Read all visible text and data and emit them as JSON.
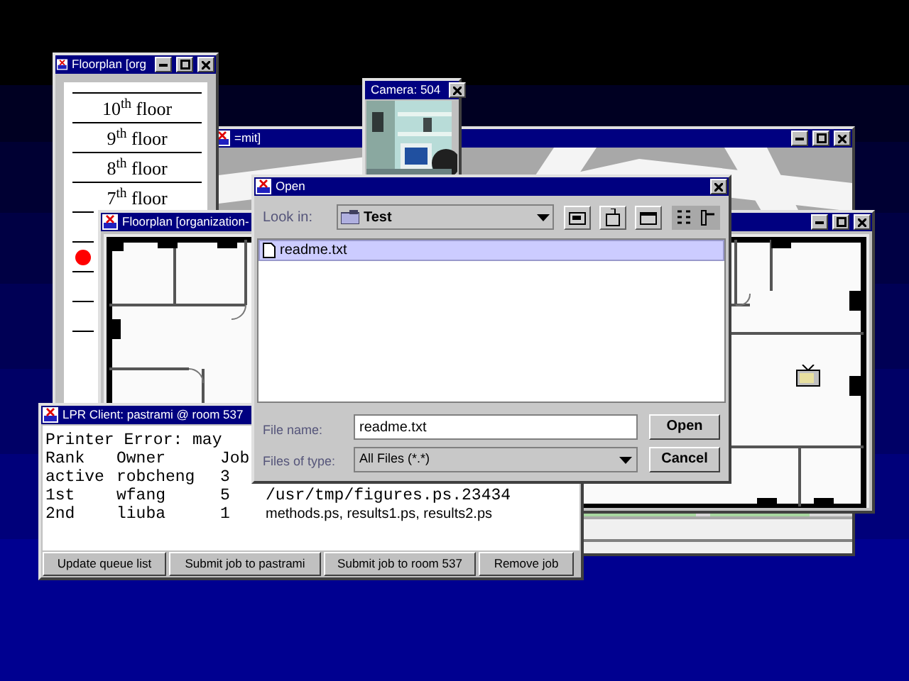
{
  "map_window": {
    "title": "=mit]"
  },
  "floor_window": {
    "title": "Floorplan [org",
    "floors": [
      {
        "label": "10$^{th}$ floor",
        "marked": false
      },
      {
        "label": "9$^{th}$ floor",
        "marked": false
      },
      {
        "label": "8$^{th}$ floor",
        "marked": false
      },
      {
        "label": "7$^{th}$ floor",
        "marked": false
      },
      {
        "marked": false
      },
      {
        "marked": true
      },
      {
        "marked": false
      },
      {
        "marked": false
      },
      {
        "marked": false
      }
    ]
  },
  "floorplan_window": {
    "title": "Floorplan [organization-"
  },
  "camera_window": {
    "title": "Camera: 504"
  },
  "lpr_window": {
    "title": "LPR Client: pastrami @ room 537",
    "status": "Printer Error: may",
    "columns": [
      "Rank",
      "Owner",
      "Job"
    ],
    "rows": [
      {
        "rank": "active",
        "owner": "robcheng",
        "job": "3"
      },
      {
        "rank": "1st",
        "owner": "wfang",
        "job": "5",
        "files": "/usr/tmp/figures.ps.23434"
      },
      {
        "rank": "2nd",
        "owner": "liuba",
        "job": "1",
        "files": "methods.ps, results1.ps, results2.ps"
      }
    ],
    "buttons": [
      "Update queue list",
      "Submit job to pastrami",
      "Submit job to room 537",
      "Remove job"
    ]
  },
  "open_dialog": {
    "title": "Open",
    "look_in_label": "Look in:",
    "look_in_value": "Test",
    "files": [
      {
        "name": "readme.txt",
        "selected": true
      }
    ],
    "file_name_label": "File name:",
    "file_name_value": "readme.txt",
    "file_type_label": "Files of type:",
    "file_type_value": "All Files (*.*)",
    "buttons": [
      "Open",
      "Cancel"
    ]
  }
}
